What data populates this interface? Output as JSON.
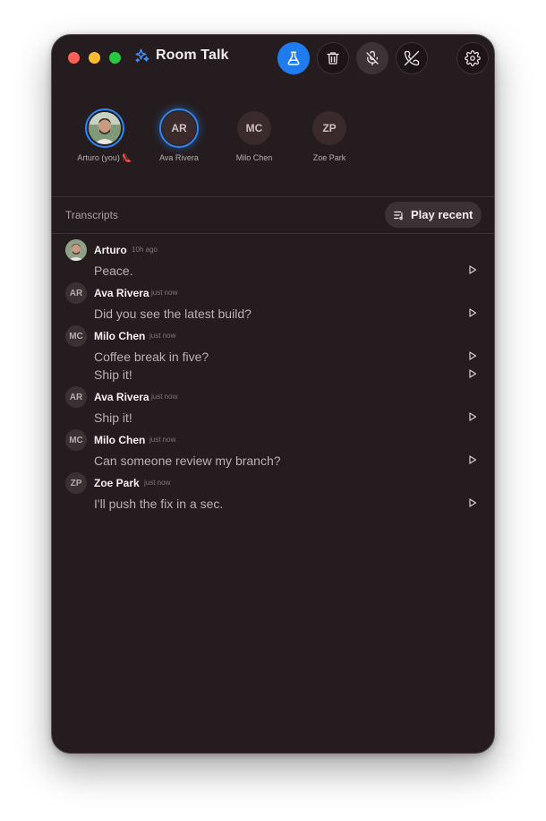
{
  "app": {
    "title": "Room Talk",
    "accent": "#1e7cf0",
    "toolbar": {
      "icons": [
        "flask-icon",
        "trash-icon",
        "mic-off-icon",
        "phone-off-icon",
        "gear-icon"
      ]
    }
  },
  "participants": [
    {
      "name": "Arturo (you) 👠",
      "initials": "",
      "photo": true,
      "speaking": true
    },
    {
      "name": "Ava Rivera",
      "initials": "AR",
      "speaking": true
    },
    {
      "name": "Milo Chen",
      "initials": "MC",
      "speaking": false
    },
    {
      "name": "Zoe Park",
      "initials": "ZP",
      "speaking": false
    }
  ],
  "transcripts": {
    "label": "Transcripts",
    "play_recent_label": "Play recent",
    "messages": [
      {
        "author": "Arturo",
        "initials": "",
        "photo": true,
        "time": "10h ago",
        "lines": [
          "Peace."
        ]
      },
      {
        "author": "Ava Rivera",
        "initials": "AR",
        "time": "just now",
        "lines": [
          "Did you see the latest build?"
        ]
      },
      {
        "author": "Milo Chen",
        "initials": "MC",
        "time": "just now",
        "lines": [
          "Coffee break in five?",
          "Ship it!"
        ]
      },
      {
        "author": "Ava Rivera",
        "initials": "AR",
        "time": "just now",
        "lines": [
          "Ship it!"
        ]
      },
      {
        "author": "Milo Chen",
        "initials": "MC",
        "time": "just now",
        "lines": [
          "Can someone review my branch?"
        ]
      },
      {
        "author": "Zoe Park",
        "initials": "ZP",
        "time": "just now",
        "lines": [
          "I'll push the fix in a sec."
        ]
      }
    ]
  }
}
